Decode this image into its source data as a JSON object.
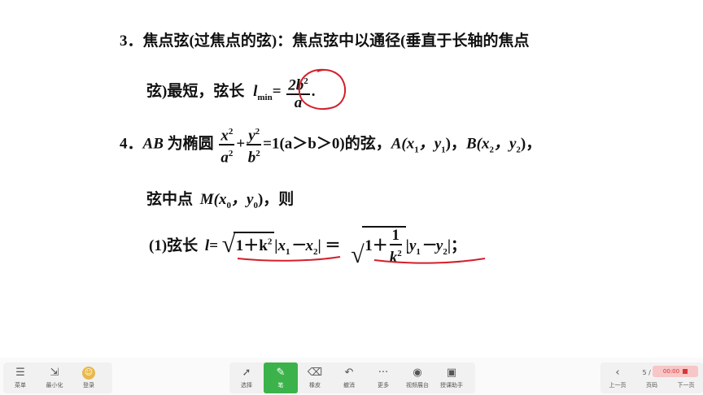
{
  "slide": {
    "item3_line1": "3．焦点弦(过焦点的弦)：焦点弦中以通径(垂直于长轴的焦点",
    "item3_line2_prefix": "弦)最短，弦长",
    "lmin_var": "l",
    "lmin_sub": "min",
    "eq": "=",
    "frac_num": "2b",
    "frac_num_sup": "2",
    "frac_den": "a",
    "period": ".",
    "item4_num": "4．",
    "item4_ab": "AB",
    "item4_text1": " 为椭圆",
    "ellipse_x": "x",
    "ellipse_a": "a",
    "ellipse_y": "y",
    "ellipse_b": "b",
    "sq": "2",
    "plus": "+",
    "item4_cond": "=1(a＞b＞0)的弦，",
    "pointA": "A(x",
    "pointA_mid": "，y",
    "pointA_end": ")，",
    "pointB": "B(x",
    "pointB_mid": "，y",
    "pointB_end": ")，",
    "sub1": "1",
    "sub2": "2",
    "sub0": "0",
    "midline_prefix": "弦中点",
    "midline_M": "M(x",
    "midline_mid": "，y",
    "midline_end": ")，则",
    "chord_prefix": "(1)弦长",
    "chord_l": "l",
    "chord_eq": "=",
    "sqrt1": "1＋k",
    "abs_x": "|x",
    "minus_x": "－x",
    "abs_close": "|",
    "chord_eq2": "＝",
    "sqrt2_one": "1＋",
    "sqrt2_num": "1",
    "sqrt2_den": "k",
    "abs_y": "|y",
    "minus_y": "－y",
    "abs_close_semi": "|；"
  },
  "toolbar": {
    "menu": "菜单",
    "minimize": "最小化",
    "login": "登录",
    "select": "选择",
    "pen": "笔",
    "eraser": "橡皮",
    "undo": "撤消",
    "more": "更多",
    "video_booth": "视频展台",
    "assistant": "授课助手",
    "prev": "上一页",
    "page_indicator": "5 / 28",
    "page_label": "页码",
    "next": "下一页",
    "rec_time": "00:00"
  },
  "colors": {
    "ink": "#d21f2a",
    "pen_active": "#3bb34a"
  }
}
